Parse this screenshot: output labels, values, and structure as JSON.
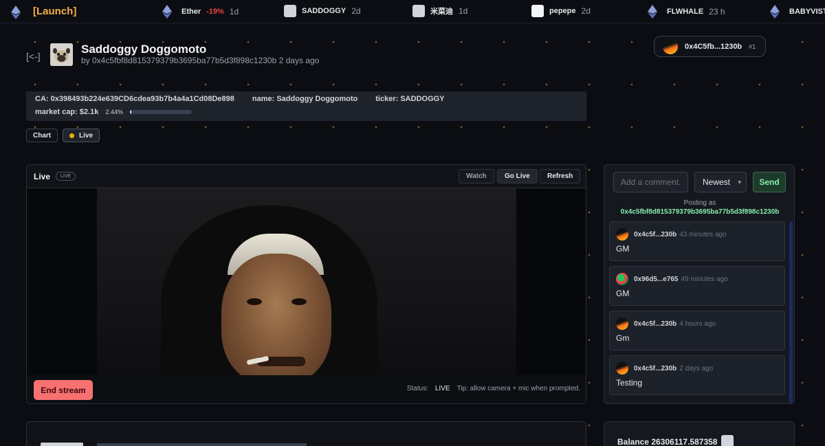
{
  "ticker": {
    "launch_label": "[Launch]",
    "items": [
      {
        "name": "Ether",
        "change": "-19%",
        "age": "1d",
        "icon": "eth-icon"
      },
      {
        "name": "SADDOGGY",
        "age": "2d",
        "icon": "token-image"
      },
      {
        "name": "米菜迪",
        "age": "1d",
        "icon": "token-image"
      },
      {
        "name": "pepepe",
        "age": "2d",
        "icon": "token-image"
      },
      {
        "name": "FLWHALE",
        "age": "23 h",
        "icon": "eth-icon"
      },
      {
        "name": "BABYVISTA",
        "icon": "eth-icon"
      }
    ]
  },
  "header": {
    "back_label": "[<-]",
    "token_name": "Saddoggy Doggomoto",
    "by_line": "by 0x4c5fbf8d815379379b3695ba77b5d3f898c1230b 2 days ago"
  },
  "wallet": {
    "address": "0x4C5fb...1230b",
    "rank": "#1"
  },
  "info": {
    "ca": "CA: 0x398493b224e639CD6cdea93b7b4a4a1Cd08De898",
    "name": "name: Saddoggy Doggomoto",
    "ticker": "ticker: SADDOGGY",
    "market_cap": "market cap: $2.1k",
    "progress_pct": "2.44%",
    "progress_fraction": 0.0244
  },
  "tabs": {
    "chart": "Chart",
    "live": "Live"
  },
  "live": {
    "title": "Live",
    "badge": "LIVE",
    "watch": "Watch",
    "go_live": "Go Live",
    "refresh": "Refresh",
    "end_stream": "End stream",
    "status_label": "Status:",
    "status_value": "LIVE",
    "tip": "Tip: allow camera + mic when prompted."
  },
  "comments": {
    "placeholder": "Add a comment..",
    "sort": "Newest",
    "send": "Send",
    "posting_as": "Posting as",
    "posting_addr": "0x4c5fbf8d815379379b3695ba77b5d3f898c1230b",
    "items": [
      {
        "addr": "0x4c5f...230b",
        "time": "43 minutes ago",
        "text": "GM"
      },
      {
        "addr": "0x96d5...e765",
        "time": "49 minutes ago",
        "text": "GM"
      },
      {
        "addr": "0x4c5f...230b",
        "time": "4 hours ago",
        "text": "Gm"
      },
      {
        "addr": "0x4c5f...230b",
        "time": "2 days ago",
        "text": "Testing"
      }
    ]
  },
  "balance": {
    "label": "Balance 26306117.587358"
  },
  "colors": {
    "accent_launch": "#f5b041",
    "negative": "#ef4444",
    "end_button": "#f87171",
    "posting_addr": "#86efac"
  }
}
